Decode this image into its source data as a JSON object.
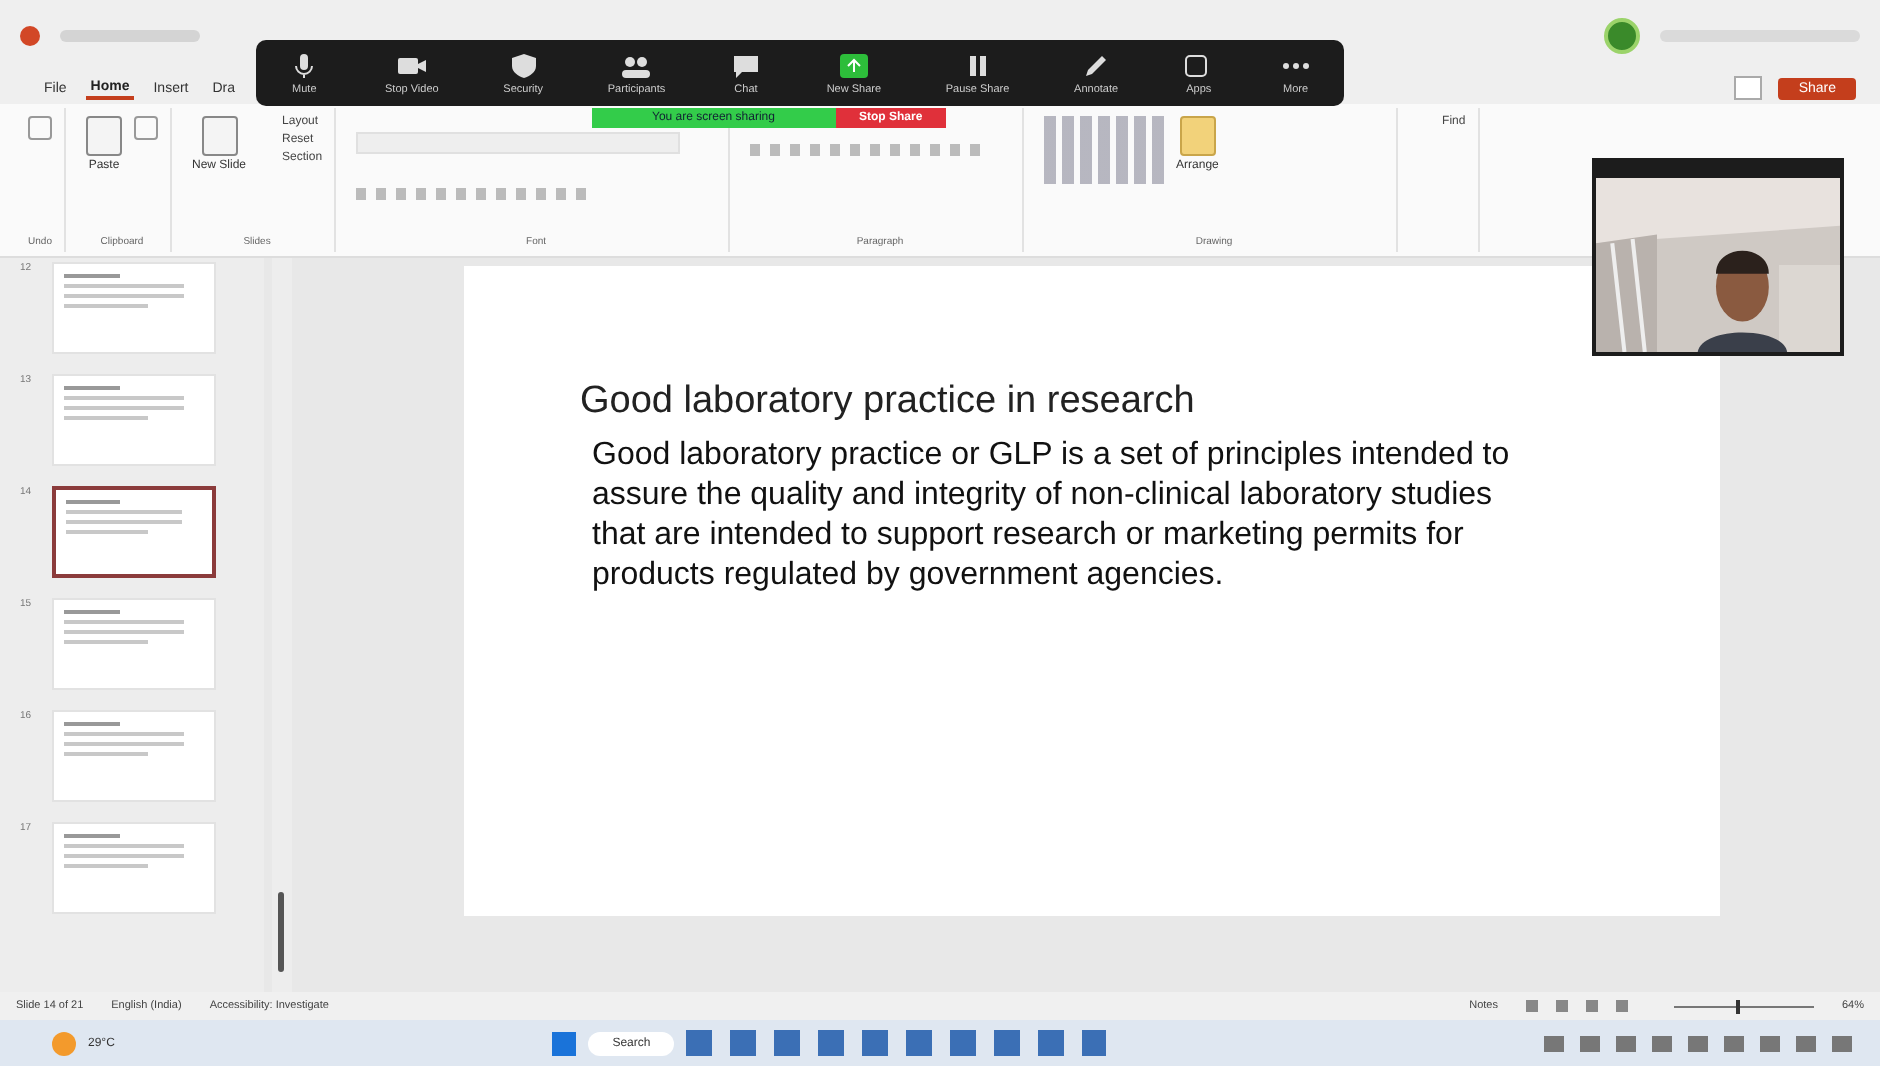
{
  "title_bar": {
    "share_button": "Share"
  },
  "zoom_toolbar": {
    "buttons": [
      {
        "label": "Mute",
        "kind": "mic"
      },
      {
        "label": "Stop Video",
        "kind": "video"
      },
      {
        "label": "Security",
        "kind": "shield"
      },
      {
        "label": "Participants",
        "kind": "people"
      },
      {
        "label": "Chat",
        "kind": "chat"
      },
      {
        "label": "New Share",
        "kind": "share"
      },
      {
        "label": "Pause Share",
        "kind": "pause"
      },
      {
        "label": "Annotate",
        "kind": "pen"
      },
      {
        "label": "Apps",
        "kind": "apps"
      },
      {
        "label": "More",
        "kind": "more"
      }
    ],
    "sharing_banner": "You are screen sharing",
    "stop_share": "Stop Share"
  },
  "ribbon": {
    "tabs": [
      {
        "label": "File",
        "selected": false
      },
      {
        "label": "Home",
        "selected": true
      },
      {
        "label": "Insert",
        "selected": false
      },
      {
        "label": "Dra",
        "selected": false
      }
    ],
    "buttons": {
      "paste": "Paste",
      "new_slide": "New Slide",
      "layout": "Layout",
      "reset": "Reset",
      "section": "Section",
      "arrange": "Arrange",
      "find": "Find"
    },
    "groups": [
      "Undo",
      "Clipboard",
      "Slides",
      "Font",
      "Paragraph",
      "Drawing"
    ]
  },
  "thumbnails": [
    {
      "number": "12",
      "selected": false
    },
    {
      "number": "13",
      "selected": false
    },
    {
      "number": "14",
      "selected": true
    },
    {
      "number": "15",
      "selected": false
    },
    {
      "number": "16",
      "selected": false
    },
    {
      "number": "17",
      "selected": false
    }
  ],
  "slide": {
    "title": "Good laboratory practice in research",
    "body": "Good laboratory practice or GLP is a set of principles intended to assure the quality and integrity of non-clinical laboratory studies that are intended to support research or marketing permits for products regulated by government agencies."
  },
  "status_bar": {
    "slide_count": "Slide 14 of 21",
    "language": "English (India)",
    "accessibility": "Accessibility: Investigate",
    "notes": "Notes",
    "zoom": "64%",
    "zoom_slider": {
      "level": 0.45
    }
  },
  "taskbar": {
    "weather_temp": "29°C",
    "search": "Search"
  }
}
